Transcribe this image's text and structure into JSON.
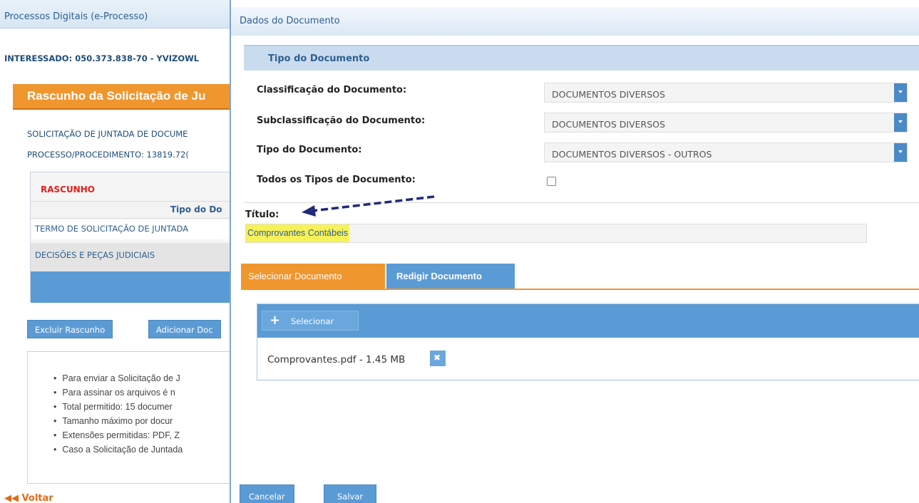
{
  "background_page": {
    "app_title": "Processos Digitais (e-Processo)",
    "interessado": "INTERESSADO: 050.373.838-70 - YVIZOWL",
    "header_title": "Rascunho da Solicitação de Ju",
    "solicitacao": "SOLICITAÇÃO DE JUNTADA DE DOCUME",
    "processo": "PROCESSO/PROCEDIMENTO: 13819.72(",
    "rascunho_label": "RASCUNHO",
    "tipo_header": "Tipo do Do",
    "rows": [
      "TERMO DE SOLICITAÇÃO DE JUNTADA",
      "DECISÕES E PEÇAS JUDICIAIS"
    ],
    "btn_excluir": "Excluir Rascunho",
    "btn_adicionar": "Adicionar Doc",
    "info_items": [
      "Para enviar a Solicitação de J",
      "Para assinar os arquivos é n",
      "Total permitido: 15 documer",
      "Tamanho máximo por docur",
      "Extensões permitidas: PDF, Z",
      "Caso a Solicitação de Juntada"
    ],
    "voltar": "Voltar"
  },
  "modal": {
    "title": "Dados do Documento",
    "section_title": "Tipo do Documento",
    "fields": {
      "classificacao_label": "Classificação do Documento:",
      "classificacao_value": "DOCUMENTOS DIVERSOS",
      "subclassificacao_label": "Subclassificação do Documento:",
      "subclassificacao_value": "DOCUMENTOS DIVERSOS",
      "tipo_label": "Tipo do Documento:",
      "tipo_value": "DOCUMENTOS DIVERSOS - OUTROS",
      "todos_tipos_label": "Todos os Tipos de Documento:",
      "todos_tipos_checked": false
    },
    "titulo_label": "Título:",
    "titulo_value": "Comprovantes Contábeis",
    "tabs": [
      "Selecionar Documento",
      "Redigir Documento"
    ],
    "selecionar_btn": "Selecionar",
    "file_name": "Comprovantes.pdf - 1.45 MB",
    "btn_cancelar": "Cancelar",
    "btn_salvar": "Salvar"
  },
  "colors": {
    "accent_orange": "#f0962e",
    "accent_blue": "#5b9bd5",
    "highlight_yellow": "#f7f15a",
    "annotation_arrow": "#1f2a7a"
  },
  "icons": {
    "plus": "plus-icon",
    "remove_file": "close-icon",
    "select_arrow": "chevron-down-icon",
    "voltar": "double-arrow-left-icon"
  }
}
